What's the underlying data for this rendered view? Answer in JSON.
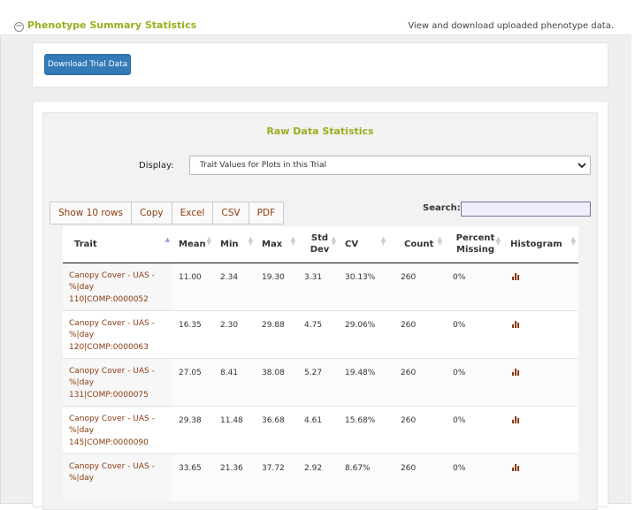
{
  "panel": {
    "title": "Phenotype Summary Statistics",
    "description": "View and download uploaded phenotype data.",
    "collapse_symbol": "−"
  },
  "download_button": "Download Trial Data",
  "raw_stats": {
    "title": "Raw Data Statistics",
    "display_label": "Display:",
    "display_selected": "Trait Values for Plots in this Trial",
    "buttons": [
      "Show 10 rows",
      "Copy",
      "Excel",
      "CSV",
      "PDF"
    ],
    "search_label": "Search:",
    "search_value": ""
  },
  "table": {
    "headers": [
      "Trait",
      "Mean",
      "Min",
      "Max",
      "Std Dev",
      "CV",
      "Count",
      "Percent Missing",
      "Histogram"
    ],
    "rows": [
      {
        "trait": "Canopy Cover - UAS - %|day 110|COMP:0000052",
        "mean": "11.00",
        "min": "2.34",
        "max": "19.30",
        "std": "3.31",
        "cv": "30.13%",
        "count": "260",
        "missing": "0%"
      },
      {
        "trait": "Canopy Cover - UAS - %|day 120|COMP:0000063",
        "mean": "16.35",
        "min": "2.30",
        "max": "29.88",
        "std": "4.75",
        "cv": "29.06%",
        "count": "260",
        "missing": "0%"
      },
      {
        "trait": "Canopy Cover - UAS - %|day 131|COMP:0000075",
        "mean": "27.05",
        "min": "8.41",
        "max": "38.08",
        "std": "5.27",
        "cv": "19.48%",
        "count": "260",
        "missing": "0%"
      },
      {
        "trait": "Canopy Cover - UAS - %|day 145|COMP:0000090",
        "mean": "29.38",
        "min": "11.48",
        "max": "36.68",
        "std": "4.61",
        "cv": "15.68%",
        "count": "260",
        "missing": "0%"
      },
      {
        "trait": "Canopy Cover - UAS - %|day",
        "mean": "33.65",
        "min": "21.36",
        "max": "37.72",
        "std": "2.92",
        "cv": "8.67%",
        "count": "260",
        "missing": "0%"
      }
    ]
  },
  "icons": {
    "collapse": "collapse-minus-icon",
    "select": "chevron-down-icon",
    "histogram": "bar-chart-icon",
    "sort": "sort-arrows-icon"
  },
  "colors": {
    "accent_green": "#9cad1e",
    "button_blue": "#337ab7",
    "link_brown": "#8b3a0f"
  }
}
